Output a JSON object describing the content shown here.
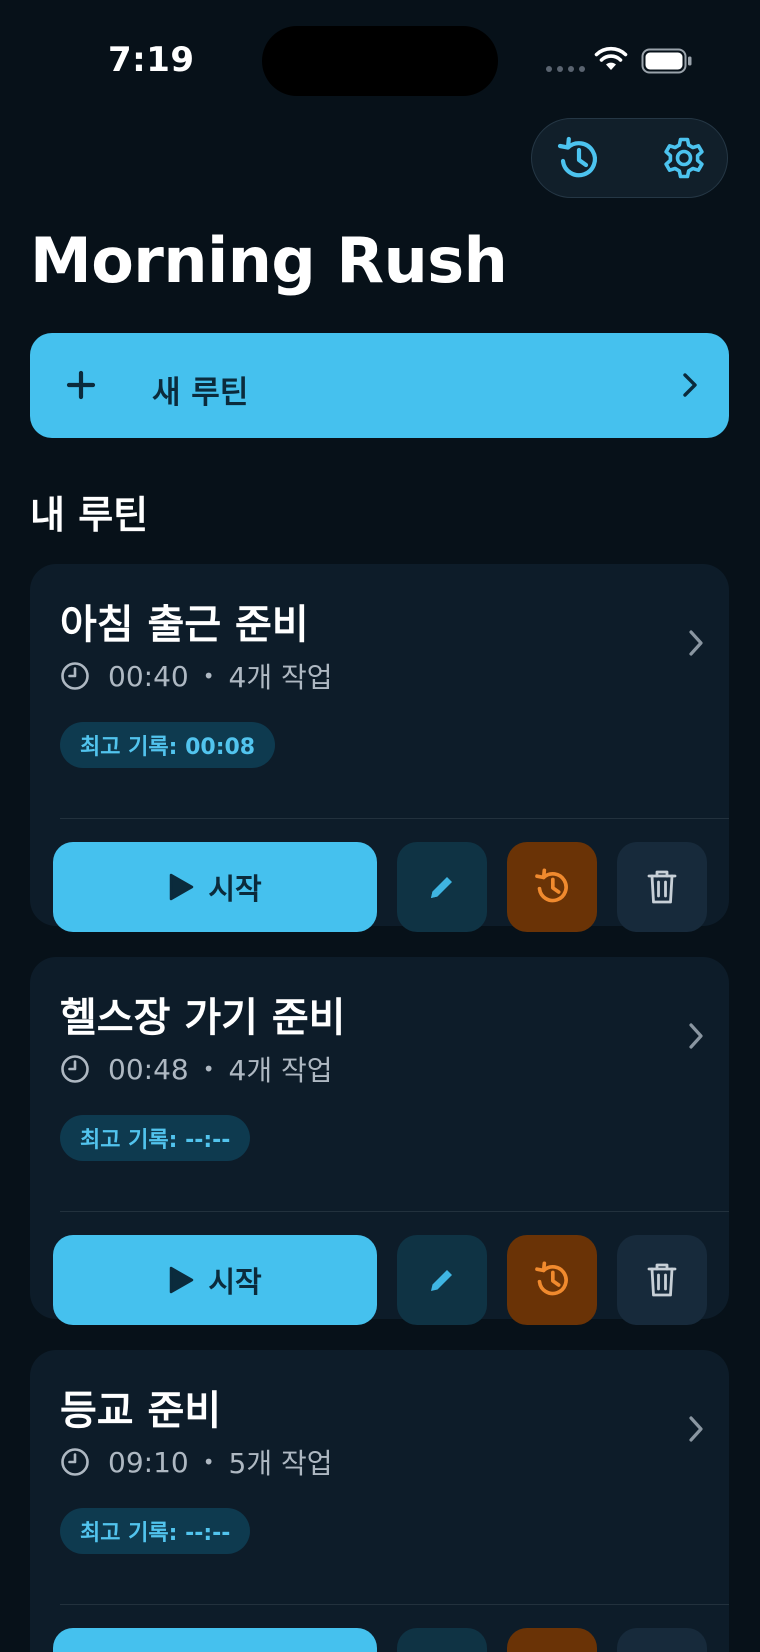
{
  "status_bar": {
    "time": "7:19"
  },
  "header": {
    "history_icon": "history-icon",
    "settings_icon": "gear-icon"
  },
  "page_title": "Morning Rush",
  "new_routine": {
    "label": "새 루틴"
  },
  "section_title": "내 루틴",
  "start_label": "시작",
  "routines": [
    {
      "title": "아침 출근 준비",
      "duration": "00:40",
      "tasks": "4개 작업",
      "best": "최고 기록: 00:08"
    },
    {
      "title": "헬스장 가기 준비",
      "duration": "00:48",
      "tasks": "4개 작업",
      "best": "최고 기록: --:--"
    },
    {
      "title": "등교 준비",
      "duration": "09:10",
      "tasks": "5개 작업",
      "best": "최고 기록: --:--"
    }
  ],
  "colors": {
    "background": "#071119",
    "accent": "#45c1ee",
    "card": "#0d1c29",
    "record": "#f08a2e",
    "record_bg": "#6a3306"
  }
}
